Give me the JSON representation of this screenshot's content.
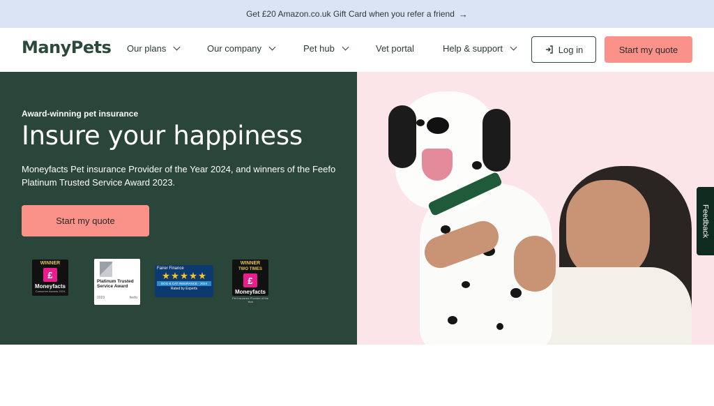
{
  "banner": {
    "text": "Get £20 Amazon.co.uk Gift Card when you refer a friend",
    "arrow": "→"
  },
  "nav": {
    "logo": "ManyPets",
    "items": [
      {
        "label": "Our plans",
        "has_dropdown": true
      },
      {
        "label": "Our company",
        "has_dropdown": true
      },
      {
        "label": "Pet hub",
        "has_dropdown": true
      },
      {
        "label": "Vet portal",
        "has_dropdown": false
      },
      {
        "label": "Help & support",
        "has_dropdown": true
      }
    ],
    "login_label": "Log in",
    "login_icon": "login-arrow-icon",
    "quote_label": "Start my quote"
  },
  "hero": {
    "eyebrow": "Award-winning pet insurance",
    "headline": "Insure your happiness",
    "subcopy": "Moneyfacts Pet insurance Provider of the Year 2024, and winners of the Feefo Platinum Trusted Service Award 2023.",
    "cta_label": "Start my quote",
    "awards": {
      "moneyfacts1": {
        "top": "WINNER",
        "name": "Moneyfacts",
        "small": "Consumer Awards 2024"
      },
      "feefo": {
        "title": "Platinum Trusted Service Award",
        "year": "2023",
        "brand": "feefo"
      },
      "fairer": {
        "brand": "Fairer Finance",
        "strip": "DOG & CAT INSURANCE · 2024",
        "rated": "Rated by Experts"
      },
      "moneyfacts2": {
        "top": "WINNER",
        "top2": "TWO TIMES",
        "name": "Moneyfacts",
        "caption": "Pet Insurance Provider of the Year"
      }
    }
  },
  "feedback_label": "Feedback",
  "colors": {
    "banner_bg": "#dbe4f5",
    "hero_green": "#2a4539",
    "cta_coral": "#fb928a",
    "hero_pink": "#fce5e8"
  }
}
